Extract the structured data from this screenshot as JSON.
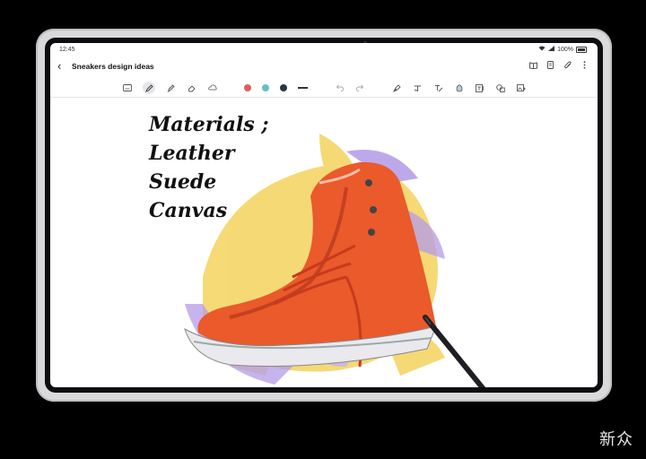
{
  "status": {
    "time": "12:45",
    "battery": "100%"
  },
  "note": {
    "title": "Sneakers design ideas"
  },
  "toolbar": {
    "colors": [
      "#e55b5b",
      "#66c1c1",
      "#263743"
    ]
  },
  "handwriting": {
    "line1": "Materials ;",
    "line2": "Leather",
    "line3": "Suede",
    "line4": "Canvas"
  },
  "watermark": {
    "text": "新众"
  }
}
